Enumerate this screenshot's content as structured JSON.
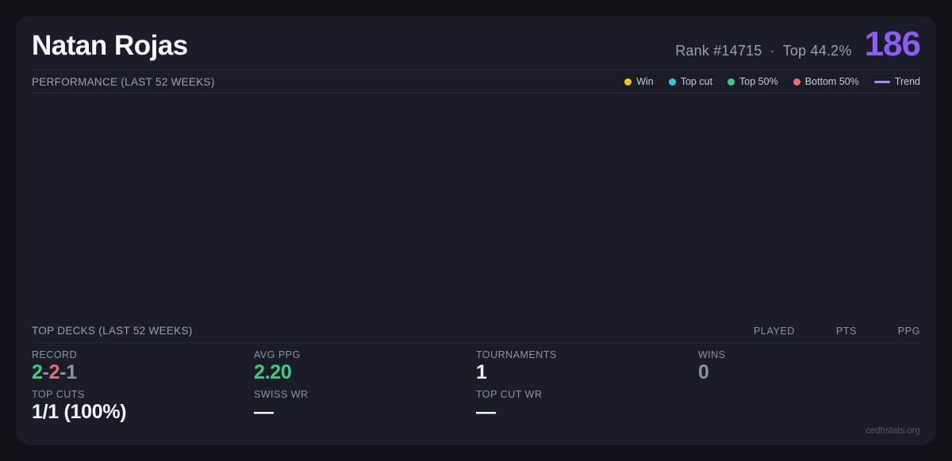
{
  "header": {
    "player_name": "Natan Rojas",
    "rank_text": "Rank #14715",
    "separator": "·",
    "top_percent_text": "Top 44.2%",
    "score": "186"
  },
  "performance": {
    "section_title": "PERFORMANCE (LAST 52 WEEKS)",
    "legend": [
      {
        "label": "Win",
        "color": "#f2c21d",
        "marker": "dot"
      },
      {
        "label": "Top cut",
        "color": "#27cbe2",
        "marker": "dot"
      },
      {
        "label": "Top 50%",
        "color": "#35d07f",
        "marker": "dot"
      },
      {
        "label": "Bottom 50%",
        "color": "#f2696d",
        "marker": "dot"
      },
      {
        "label": "Trend",
        "color": "#a78bfa",
        "marker": "line"
      }
    ],
    "points": []
  },
  "top_decks": {
    "section_title": "TOP DECKS (LAST 52 WEEKS)",
    "columns": [
      "PLAYED",
      "PTS",
      "PPG"
    ],
    "rows": []
  },
  "stats": {
    "record": {
      "label": "RECORD",
      "win": "2",
      "sep1": "-",
      "loss": "2",
      "sep2": "-",
      "draw": "1"
    },
    "avg_ppg": {
      "label": "AVG PPG",
      "value": "2.20"
    },
    "tournaments": {
      "label": "TOURNAMENTS",
      "value": "1"
    },
    "wins": {
      "label": "WINS",
      "value": "0"
    },
    "top_cuts": {
      "label": "TOP CUTS",
      "value": "1/1 (100%)"
    },
    "swiss_wr": {
      "label": "SWISS WR",
      "value": "—"
    },
    "top_cut_wr": {
      "label": "TOP CUT WR",
      "value": "—"
    }
  },
  "footer": {
    "watermark": "cedhstats.org"
  },
  "colors": {
    "background": "#101117",
    "card": "#1a1d27",
    "accent_purple": "#8b5cf6",
    "trend_purple": "#a78bfa",
    "win_yellow": "#f2c21d",
    "topcut_cyan": "#27cbe2",
    "green": "#35d07f",
    "red": "#f2696d"
  }
}
